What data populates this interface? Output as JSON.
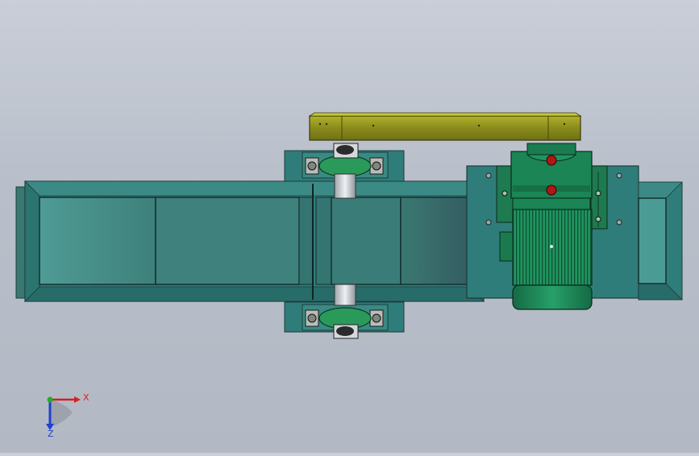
{
  "window": {
    "title": ""
  },
  "colors": {
    "background": "#bcc2cc",
    "body_teal": "#2f7d7a",
    "body_teal_light": "#4a9a94",
    "panel_dark": "#3d6f6d",
    "belt_guard": "#8a8b1c",
    "motor_green": "#1e8a5a",
    "shaft_steel": "#c8ccd0",
    "red_marker": "#b01616",
    "axis_x": "#d42020",
    "axis_y": "#20b020",
    "axis_z": "#2040d0"
  },
  "triad": {
    "x_label": "X",
    "z_label": "Z"
  },
  "icons": {
    "triad": "coordinate-triad-icon"
  }
}
